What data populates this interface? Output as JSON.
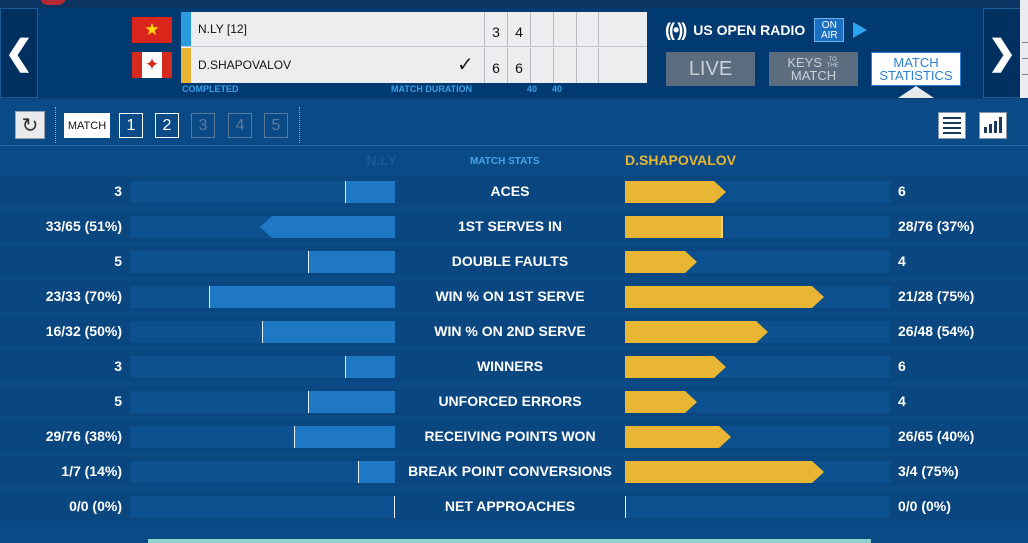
{
  "nav": {
    "prev_icon": "chevron-left-icon",
    "next_icon": "chevron-right-icon",
    "prev_glyph": "❮",
    "next_glyph": "❯"
  },
  "scoreboard": {
    "players": [
      {
        "name": "N.LY [12]",
        "flag": "vietnam-flag-icon",
        "color": "#2a9bdc",
        "sets": [
          "3",
          "4",
          "",
          "",
          ""
        ],
        "winner": false
      },
      {
        "name": "D.SHAPOVALOV",
        "flag": "canada-flag-icon",
        "color": "#e8b632",
        "sets": [
          "6",
          "6",
          "",
          "",
          ""
        ],
        "winner": true
      }
    ],
    "winner_mark": "✓",
    "status": "COMPLETED",
    "duration_label": "MATCH DURATION",
    "set_durations": [
      "40",
      "40"
    ]
  },
  "radio": {
    "label": "US OPEN RADIO",
    "on": "ON",
    "air": "AIR",
    "icon": "radio-signal-icon",
    "play_icon": "play-icon"
  },
  "top_tabs": {
    "live": "LIVE",
    "keys_line1": "KEYS",
    "keys_small": "TO THE",
    "keys_line2": "MATCH",
    "stats_line1": "MATCH",
    "stats_line2": "STATISTICS",
    "active": "stats"
  },
  "toolbar": {
    "refresh_icon": "refresh-icon",
    "refresh_glyph": "↻",
    "match_label": "MATCH",
    "sets": [
      {
        "label": "1",
        "enabled": true
      },
      {
        "label": "2",
        "enabled": true
      },
      {
        "label": "3",
        "enabled": false
      },
      {
        "label": "4",
        "enabled": false
      },
      {
        "label": "5",
        "enabled": false
      }
    ],
    "list_icon": "list-view-icon",
    "chart_icon": "bar-chart-view-icon"
  },
  "stats_header": {
    "player1": "N.LY",
    "middle": "MATCH STATS",
    "player2": "D.SHAPOVALOV"
  },
  "colors": {
    "player1": "#1e78c4",
    "player2": "#e8b632",
    "background": "#0a4a86"
  },
  "stats": [
    {
      "label": "ACES",
      "p1": "3",
      "p2": "6",
      "p1_fill": 0.19,
      "p2_fill": 0.38,
      "p1_arrow": false,
      "p2_arrow": true
    },
    {
      "label": "1ST SERVES IN",
      "p1": "33/65 (51%)",
      "p2": "28/76 (37%)",
      "p1_fill": 0.51,
      "p2_fill": 0.37,
      "p1_arrow": true,
      "p2_arrow": false
    },
    {
      "label": "DOUBLE FAULTS",
      "p1": "5",
      "p2": "4",
      "p1_fill": 0.33,
      "p2_fill": 0.27,
      "p1_arrow": false,
      "p2_arrow": true
    },
    {
      "label": "WIN % ON 1ST SERVE",
      "p1": "23/33 (70%)",
      "p2": "21/28 (75%)",
      "p1_fill": 0.7,
      "p2_fill": 0.75,
      "p1_arrow": false,
      "p2_arrow": true
    },
    {
      "label": "WIN % ON 2ND SERVE",
      "p1": "16/32 (50%)",
      "p2": "26/48 (54%)",
      "p1_fill": 0.5,
      "p2_fill": 0.54,
      "p1_arrow": false,
      "p2_arrow": true
    },
    {
      "label": "WINNERS",
      "p1": "3",
      "p2": "6",
      "p1_fill": 0.19,
      "p2_fill": 0.38,
      "p1_arrow": false,
      "p2_arrow": true
    },
    {
      "label": "UNFORCED ERRORS",
      "p1": "5",
      "p2": "4",
      "p1_fill": 0.33,
      "p2_fill": 0.27,
      "p1_arrow": false,
      "p2_arrow": true
    },
    {
      "label": "RECEIVING POINTS WON",
      "p1": "29/76 (38%)",
      "p2": "26/65 (40%)",
      "p1_fill": 0.38,
      "p2_fill": 0.4,
      "p1_arrow": false,
      "p2_arrow": true
    },
    {
      "label": "BREAK POINT CONVERSIONS",
      "p1": "1/7 (14%)",
      "p2": "3/4 (75%)",
      "p1_fill": 0.14,
      "p2_fill": 0.75,
      "p1_arrow": false,
      "p2_arrow": true
    },
    {
      "label": "NET APPROACHES",
      "p1": "0/0 (0%)",
      "p2": "0/0 (0%)",
      "p1_fill": 0,
      "p2_fill": 0,
      "p1_arrow": false,
      "p2_arrow": false
    }
  ]
}
